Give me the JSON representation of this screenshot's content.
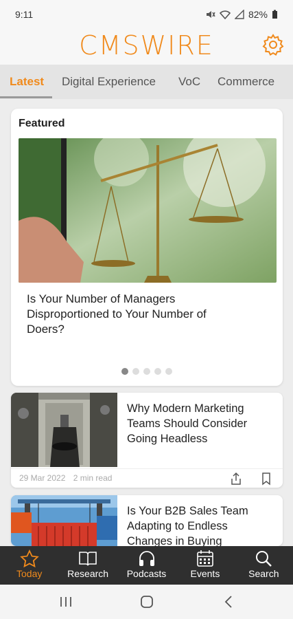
{
  "status_bar": {
    "time": "9:11",
    "battery": "82%",
    "icons": [
      "mute-icon",
      "wifi-icon",
      "signal-icon",
      "battery-icon"
    ]
  },
  "header": {
    "logo_text": "CMSWIRE",
    "settings_icon": "gear-icon",
    "brand_color": "#f08a1c"
  },
  "tabs": [
    {
      "label": "Latest",
      "active": true
    },
    {
      "label": "Digital Experience",
      "active": false
    },
    {
      "label": "VoC",
      "active": false
    },
    {
      "label": "Commerce",
      "active": false
    }
  ],
  "featured": {
    "section_label": "Featured",
    "title": "Is Your Number of Managers Disproportioned to Your Number of Doers?",
    "image_icon": "balance-scale-image",
    "slides_total": 5,
    "current_slide": 1
  },
  "articles": [
    {
      "title": "Why Modern Marketing Teams Should Consider Going Headless",
      "date": "29 Mar 2022",
      "read_time": "2 min read",
      "image_icon": "headless-figure-image"
    },
    {
      "title": "Is Your B2B Sales Team Adapting to Endless Changes in Buying",
      "image_icon": "shipping-containers-image"
    }
  ],
  "bottom_nav": [
    {
      "label": "Today",
      "icon": "star-icon",
      "active": true
    },
    {
      "label": "Research",
      "icon": "book-icon",
      "active": false
    },
    {
      "label": "Podcasts",
      "icon": "headphones-icon",
      "active": false
    },
    {
      "label": "Events",
      "icon": "calendar-icon",
      "active": false
    },
    {
      "label": "Search",
      "icon": "search-icon",
      "active": false
    }
  ],
  "system_nav": [
    "recents-icon",
    "home-icon",
    "back-icon"
  ]
}
